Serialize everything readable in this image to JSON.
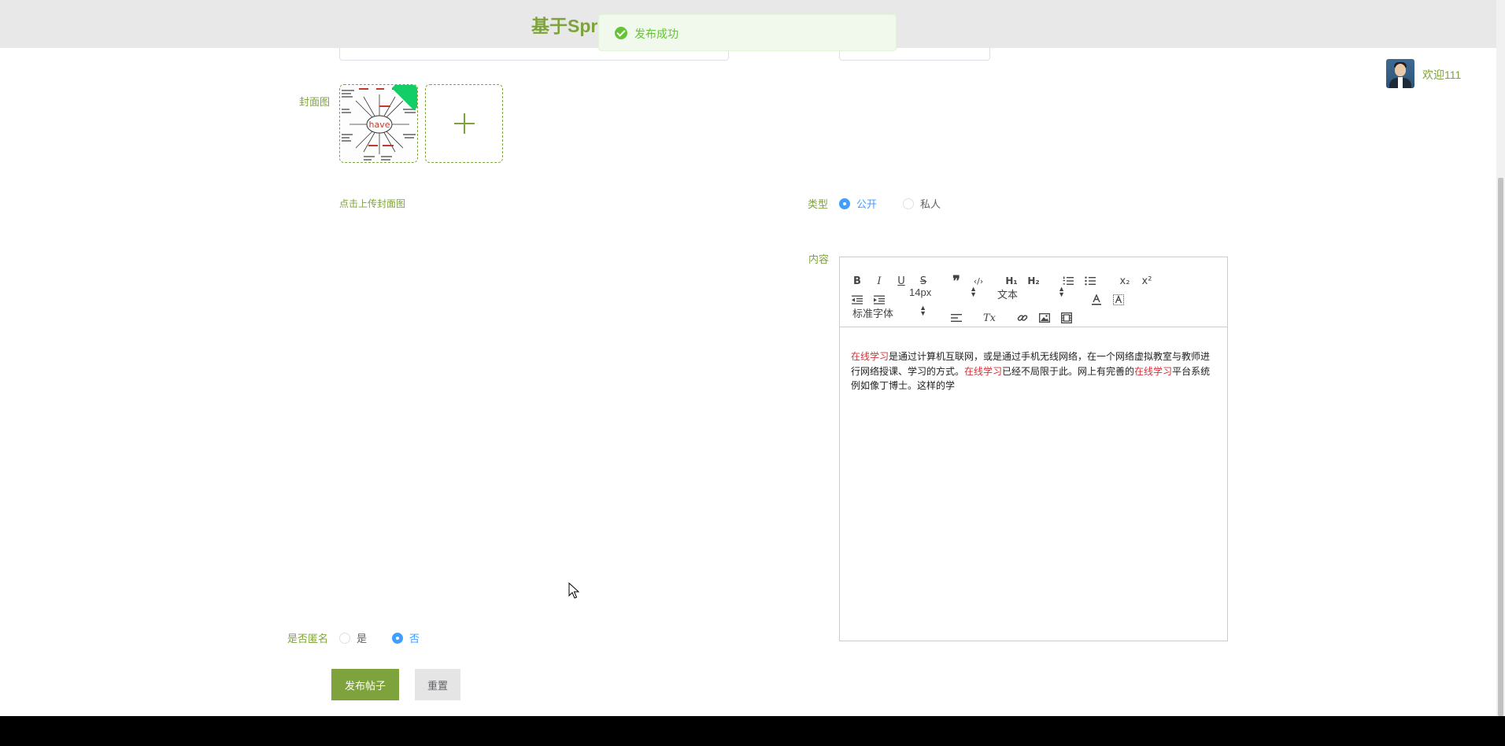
{
  "header": {
    "title": "基于Spri"
  },
  "toast": {
    "message": "发布成功"
  },
  "user": {
    "welcome": "欢迎111"
  },
  "form": {
    "title_value_partial": "",
    "cover": {
      "label": "封面图",
      "tip": "点击上传封面图"
    },
    "type": {
      "label": "类型",
      "options": [
        "公开",
        "私人"
      ],
      "selected": "公开"
    },
    "content": {
      "label": "内容",
      "toolbar": {
        "bold": "B",
        "italic": "I",
        "underline": "U",
        "strike": "S",
        "blockquote": "❞",
        "code": "‹/›",
        "h1": "H₁",
        "h2": "H₂",
        "ordered_list_icon": "ordered-list-icon",
        "bullet_list_icon": "bullet-list-icon",
        "sub": "x₂",
        "sup": "x²",
        "size": "14px",
        "header_select": "文本",
        "font": "标准字体",
        "clean": "Tx"
      },
      "body": {
        "p1": "在线学习",
        "p2": "是通过计算机互联网，或是通过手机无线网络，在一个网络虚拟教室与教师进行网络授课、学习的方式。",
        "p3": "在线学习",
        "p4": "已经不局限于此。网上有完善的",
        "p5": "在线学习",
        "p6": "平台系统例如像丁博士。这样的学"
      }
    },
    "anonymous": {
      "label": "是否匿名",
      "options": [
        "是",
        "否"
      ],
      "selected": "否"
    },
    "buttons": {
      "submit": "发布帖子",
      "reset": "重置"
    }
  },
  "colors": {
    "accent": "#7fa33c",
    "radio_checked": "#409eff",
    "success": "#67c23a",
    "highlight": "#d0343b"
  }
}
